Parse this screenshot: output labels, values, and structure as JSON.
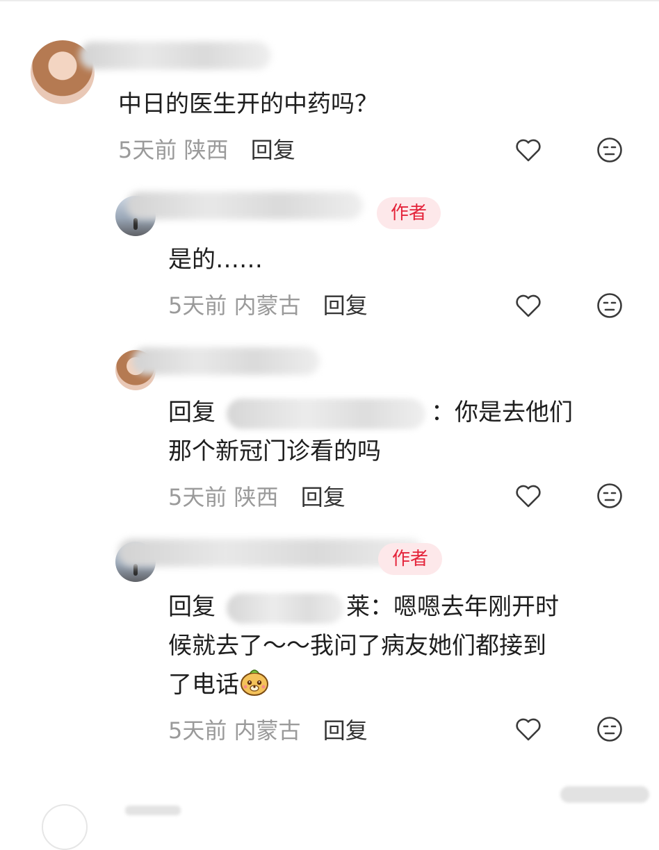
{
  "comments": [
    {
      "text": "中日的医生开的中药吗？",
      "time": "5天前",
      "location": "陕西",
      "reply": "回复"
    },
    {
      "author_tag": "作者",
      "text": "是的……",
      "time": "5天前",
      "location": "内蒙古",
      "reply": "回复"
    },
    {
      "reply_prefix": "回复",
      "line1_suffix": "：你是去他们",
      "line2": "那个新冠门诊看的吗",
      "time": "5天前",
      "location": "陕西",
      "reply": "回复"
    },
    {
      "author_tag": "作者",
      "reply_prefix": "回复",
      "line1_suffix": "莱：嗯嗯去年刚开时",
      "line2": "候就去了～～我问了病友她们都接到",
      "line3": "了电话",
      "emoji": "dog-face-emoji",
      "time": "5天前",
      "location": "内蒙古",
      "reply": "回复"
    }
  ],
  "icons": {
    "like": "heart-icon",
    "dislike": "meh-face-icon"
  },
  "colors": {
    "author_tag_bg": "#fde8ea",
    "author_tag_text": "#e4233a",
    "meta": "#9a9a9a"
  }
}
